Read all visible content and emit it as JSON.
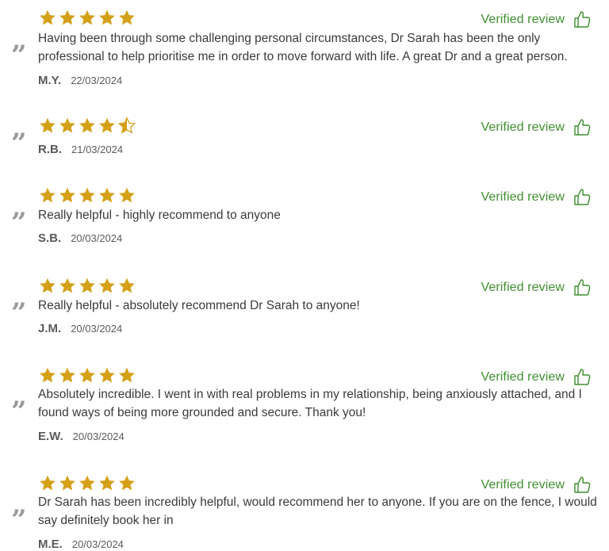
{
  "colors": {
    "star_gold": "#d4a017",
    "verified_green": "#3f8f2f",
    "quote_grey": "#9a9a9a"
  },
  "reviews": [
    {
      "rating": 5,
      "verified_label": "Verified review",
      "text": "Having been through some challenging personal circumstances, Dr Sarah has been the only professional to help prioritise me in order to move forward with life. A great Dr and a great person.",
      "initials": "M.Y.",
      "date": "22/03/2024",
      "quote_mark": "”"
    },
    {
      "rating": 4.5,
      "verified_label": "Verified review",
      "text": "",
      "initials": "R.B.",
      "date": "21/03/2024",
      "quote_mark": "”"
    },
    {
      "rating": 5,
      "verified_label": "Verified review",
      "text": "Really helpful - highly recommend to anyone",
      "initials": "S.B.",
      "date": "20/03/2024",
      "quote_mark": "”"
    },
    {
      "rating": 5,
      "verified_label": "Verified review",
      "text": "Really helpful - absolutely recommend Dr Sarah to anyone!",
      "initials": "J.M.",
      "date": "20/03/2024",
      "quote_mark": "”"
    },
    {
      "rating": 5,
      "verified_label": "Verified review",
      "text": "Absolutely incredible. I went in with real problems in my relationship, being anxiously attached, and I found ways of being more grounded and secure. Thank you!",
      "initials": "E.W.",
      "date": "20/03/2024",
      "quote_mark": "”"
    },
    {
      "rating": 5,
      "verified_label": "Verified review",
      "text": "Dr Sarah has been incredibly helpful, would recommend her to anyone. If you are on the fence, I would say definitely book her in",
      "initials": "M.E.",
      "date": "20/03/2024",
      "quote_mark": "”"
    }
  ],
  "icons": {
    "star": "star-icon",
    "half_star": "half-star-icon",
    "thumb": "thumbs-up-icon",
    "quote": "quote-icon"
  }
}
